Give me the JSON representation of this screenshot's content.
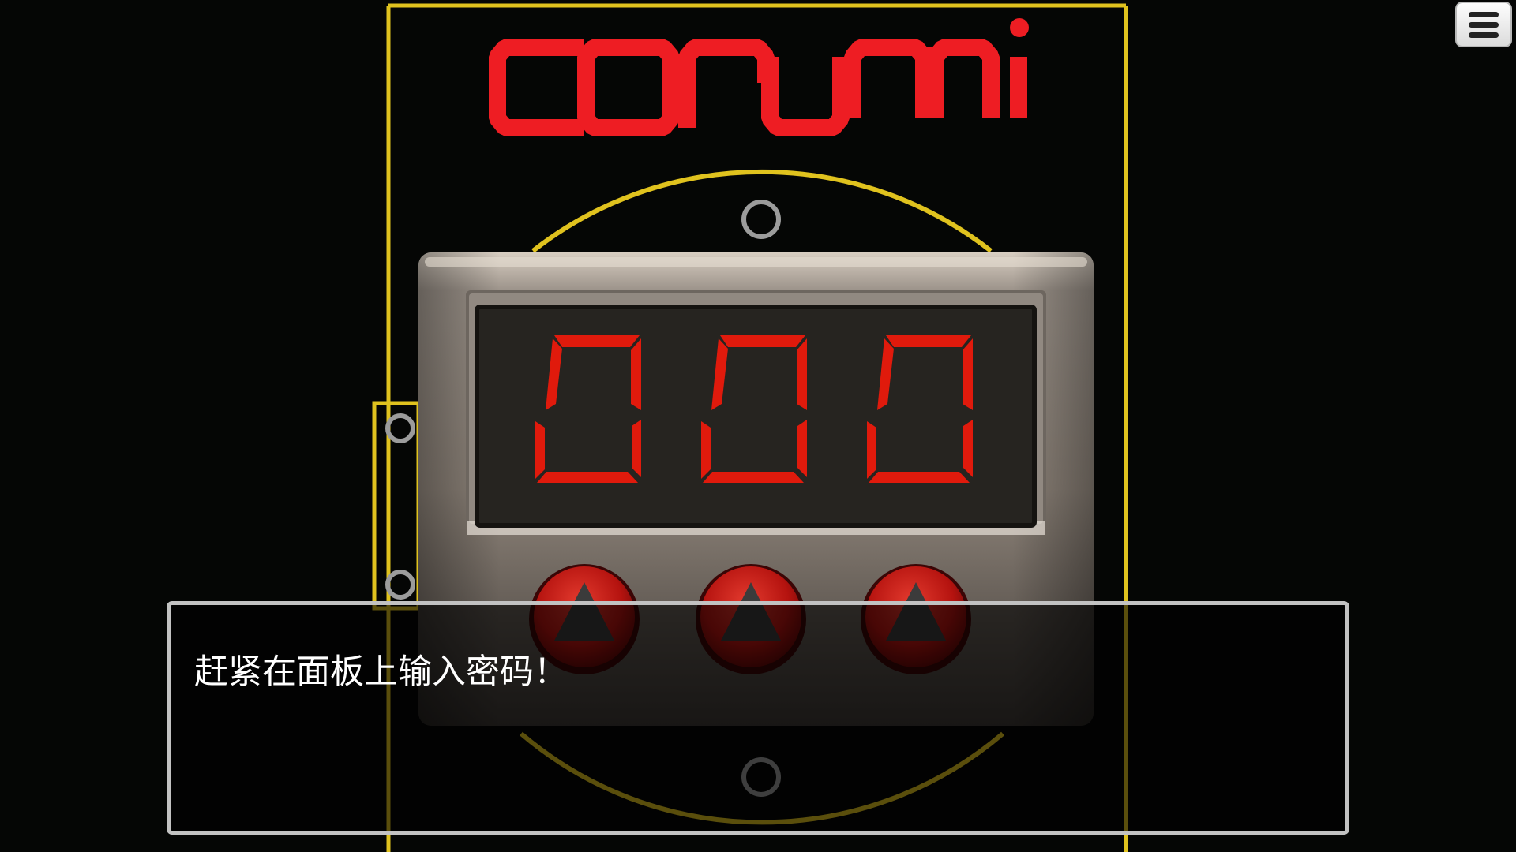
{
  "logo": {
    "text": "conum",
    "color": "#ee1d23"
  },
  "lock": {
    "display_digits": [
      "0",
      "0",
      "0"
    ],
    "digit_color": "#e01a0c",
    "up_button_labels": [
      "up-arrow",
      "up-arrow",
      "up-arrow"
    ]
  },
  "dialog": {
    "text": "赶紧在面板上输入密码！"
  },
  "menu": {
    "icon": "hamburger-menu-icon"
  },
  "colors": {
    "frame": "#e0c21e",
    "background": "#050605",
    "button_red": "#c41414"
  }
}
